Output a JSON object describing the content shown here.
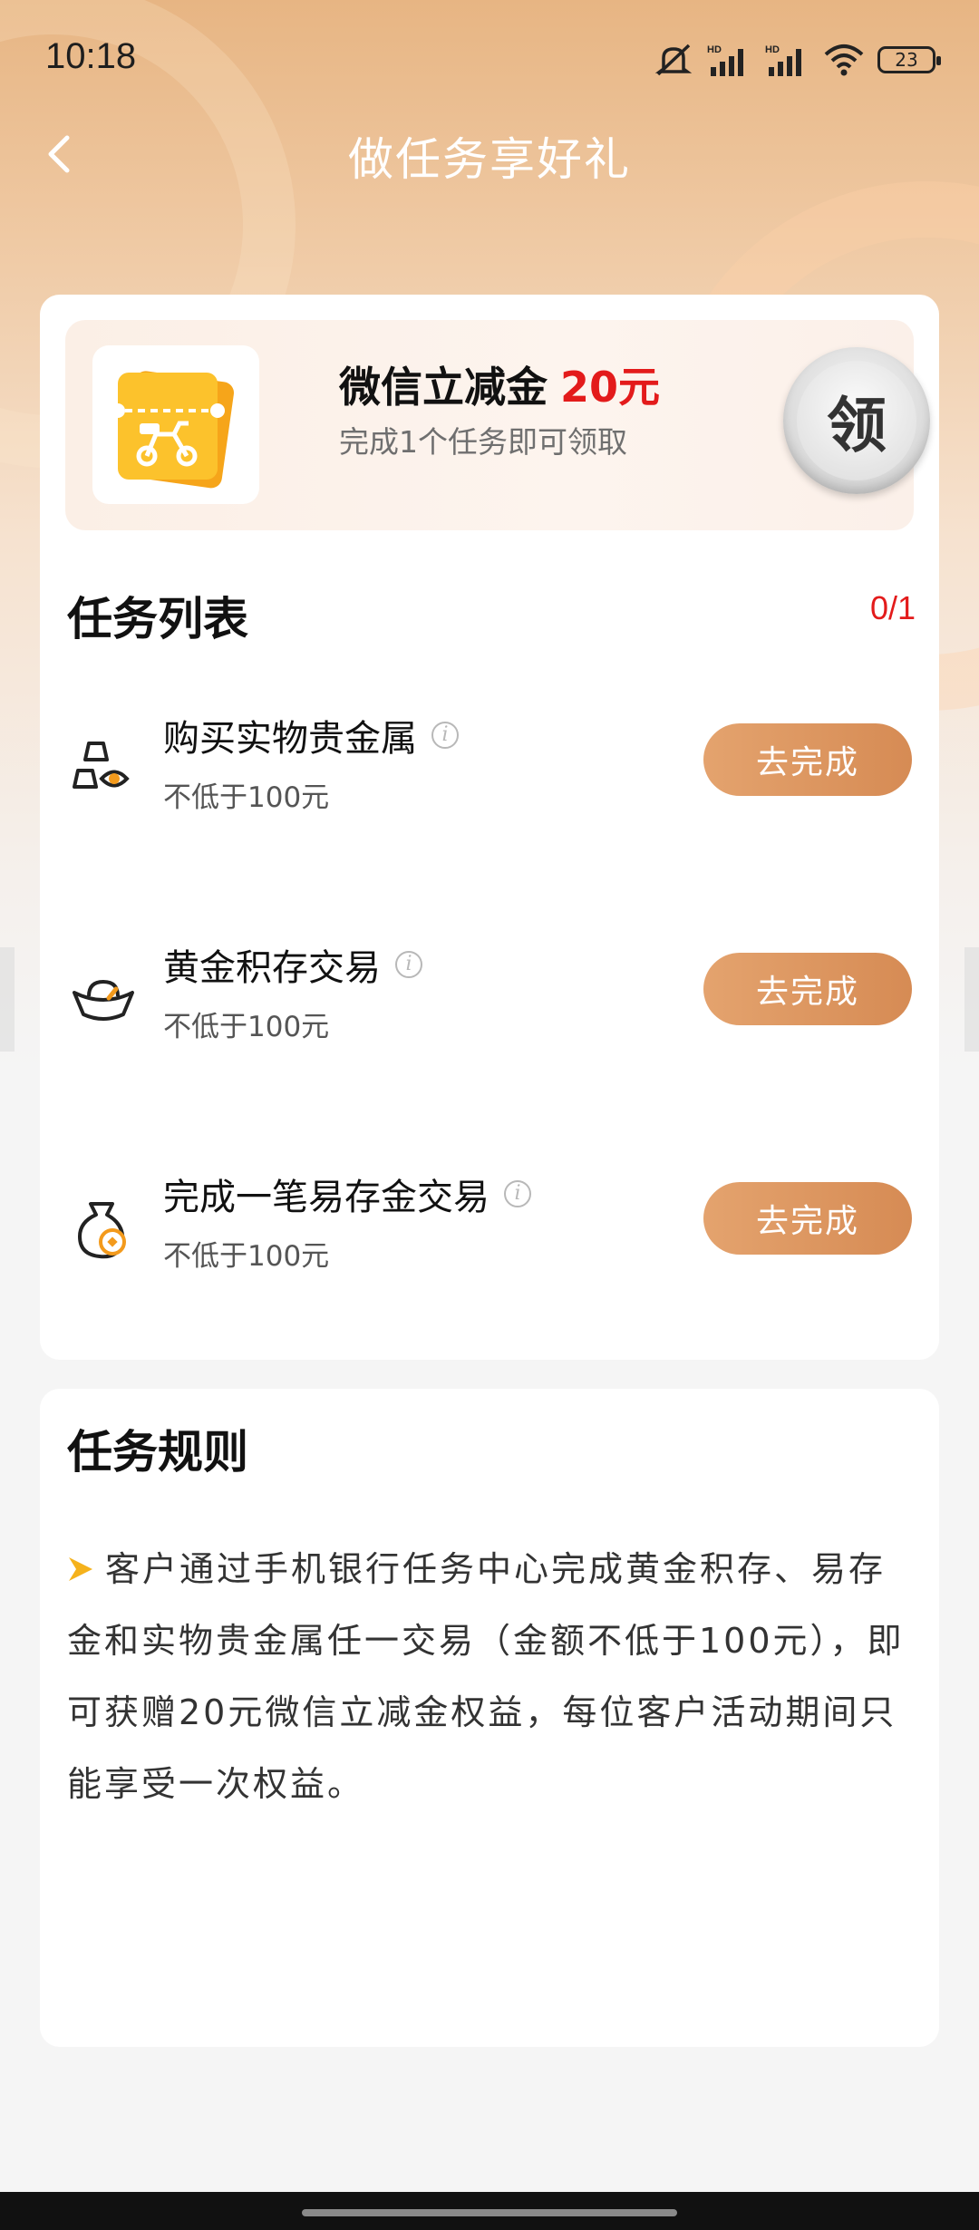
{
  "status_bar": {
    "time": "10:18",
    "battery": "23"
  },
  "header": {
    "title": "做任务享好礼"
  },
  "reward": {
    "title": "微信立减金",
    "amount": "20元",
    "subtitle": "完成1个任务即可领取",
    "claim_label": "领"
  },
  "task_list": {
    "title": "任务列表",
    "progress": "0/1",
    "tasks": [
      {
        "name": "购买实物贵金属",
        "desc": "不低于100元",
        "button": "去完成",
        "icon": "gold-bars-icon"
      },
      {
        "name": "黄金积存交易",
        "desc": "不低于100元",
        "button": "去完成",
        "icon": "gold-ingot-icon"
      },
      {
        "name": "完成一笔易存金交易",
        "desc": "不低于100元",
        "button": "去完成",
        "icon": "money-bag-icon"
      }
    ]
  },
  "rules": {
    "title": "任务规则",
    "text": "客户通过手机银行任务中心完成黄金积存、易存金和实物贵金属任一交易（金额不低于100元），即可获赠20元微信立减金权益，每位客户活动期间只能享受一次权益。"
  },
  "colors": {
    "accent": "#e31b1b",
    "button": "#dc9560",
    "header_bg": "#e7b583"
  }
}
